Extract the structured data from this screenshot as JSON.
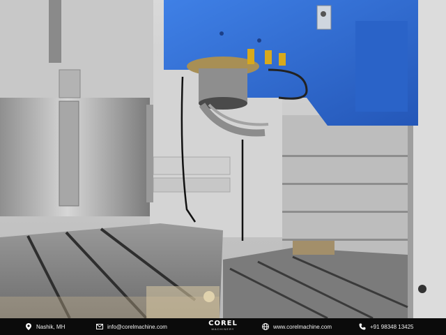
{
  "footer": {
    "location": "Nashik, MH",
    "email": "info@corelmachine.com",
    "brand_name": "COREL",
    "brand_sub": "MACHINERY",
    "website": "www.corelmachine.com",
    "phone": "+91 98348 13425"
  },
  "icons": {
    "location": "map-pin-icon",
    "email": "mail-icon",
    "website": "globe-icon",
    "phone": "phone-icon"
  },
  "colors": {
    "spindle_blue": "#2f6fd8",
    "footer_bg": "#0b0b0b",
    "footer_text": "#f2f2f2"
  }
}
